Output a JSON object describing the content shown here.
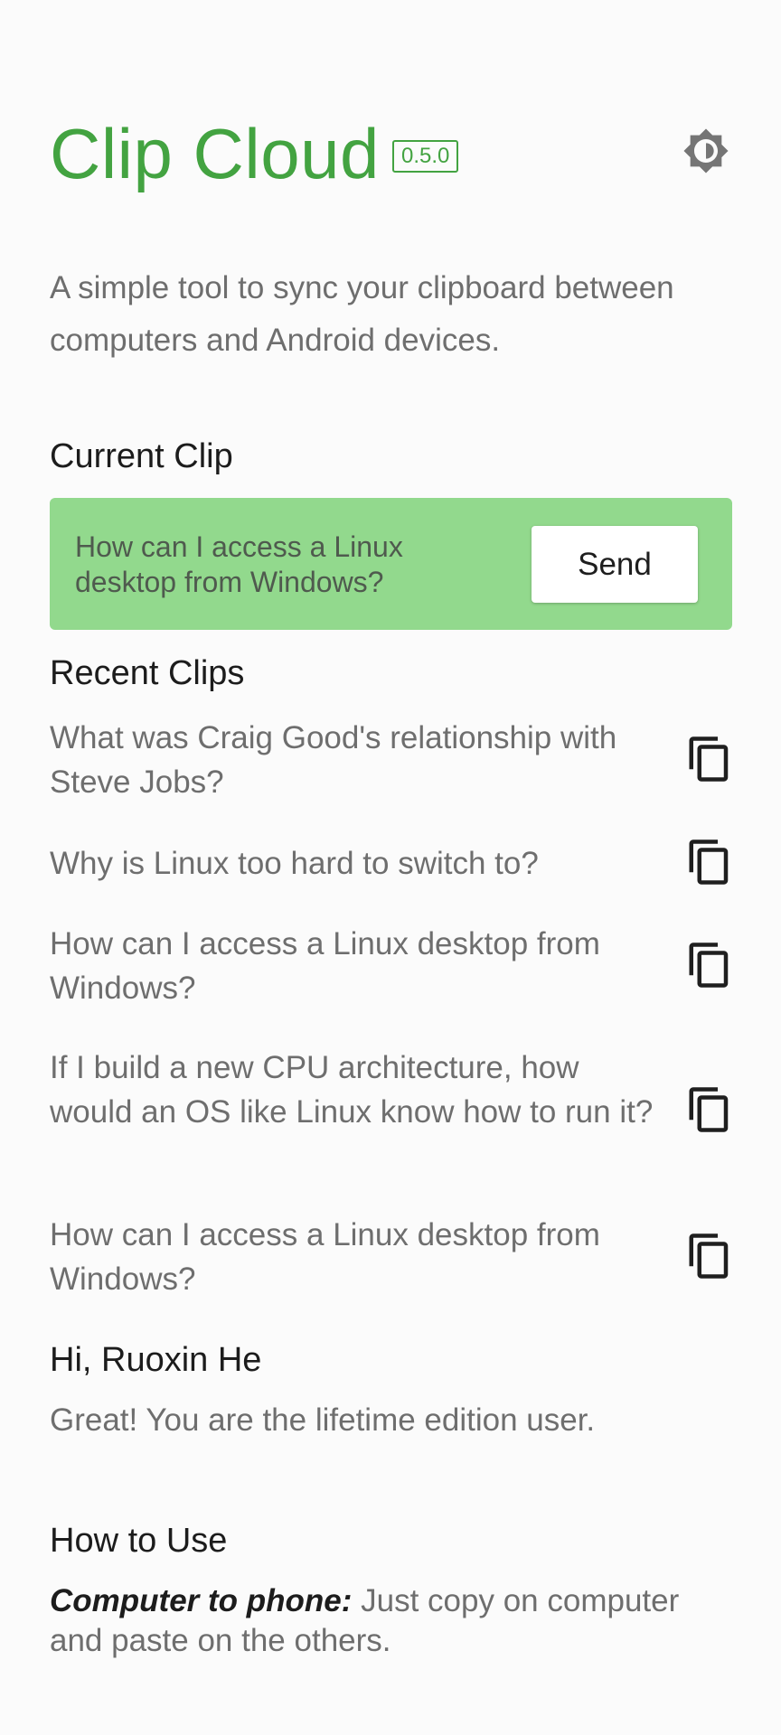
{
  "header": {
    "title": "Clip Cloud",
    "version": "0.5.0",
    "theme_icon": "brightness-icon"
  },
  "description": "A simple tool to sync your clipboard between computers and Android devices.",
  "current_clip": {
    "heading": "Current Clip",
    "text": "How can I access a Linux desktop from Windows?",
    "send_label": "Send"
  },
  "recent_clips": {
    "heading": "Recent Clips",
    "copy_icon": "copy-icon",
    "items": [
      {
        "text": "What was Craig Good's relationship with Steve Jobs?"
      },
      {
        "text": "Why is Linux too hard to switch to?"
      },
      {
        "text": "How can I access a Linux desktop from Windows?"
      },
      {
        "text": "If I build a new CPU architecture, how would an OS like Linux know how to run it?"
      },
      {
        "text": "How can I access a Linux desktop from Windows?"
      }
    ]
  },
  "account": {
    "greeting": "Hi, Ruoxin He",
    "status": "Great! You are the lifetime edition user."
  },
  "how_to_use": {
    "heading": "How to Use",
    "label": "Computer to phone:",
    "text": " Just copy on computer and paste on the others."
  },
  "colors": {
    "brand_green": "#43a341",
    "card_green": "#92d98d",
    "text_gray": "#6e6e6e"
  }
}
